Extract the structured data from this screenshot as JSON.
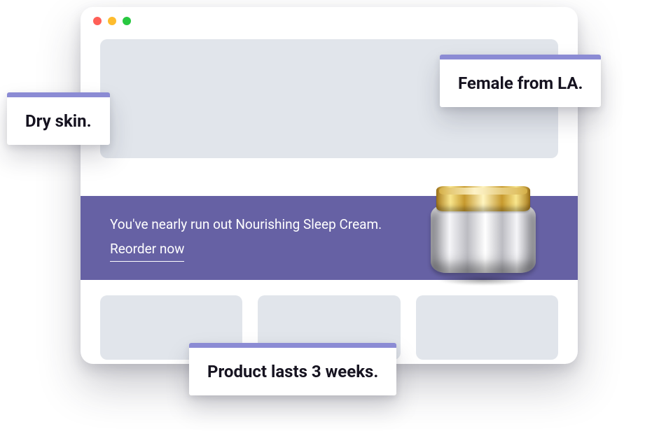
{
  "window": {
    "traffic_lights": [
      "close",
      "minimize",
      "zoom"
    ]
  },
  "banner": {
    "message": "You've nearly run out Nourishing Sleep Cream.",
    "cta": "Reorder now"
  },
  "callouts": {
    "dry_skin": "Dry skin.",
    "female_la": "Female from LA.",
    "lasts_3_weeks": "Product lasts 3 weeks."
  },
  "colors": {
    "banner_bg": "#6661a4",
    "callout_accent": "#8b8bd4",
    "placeholder": "#e1e5eb"
  }
}
